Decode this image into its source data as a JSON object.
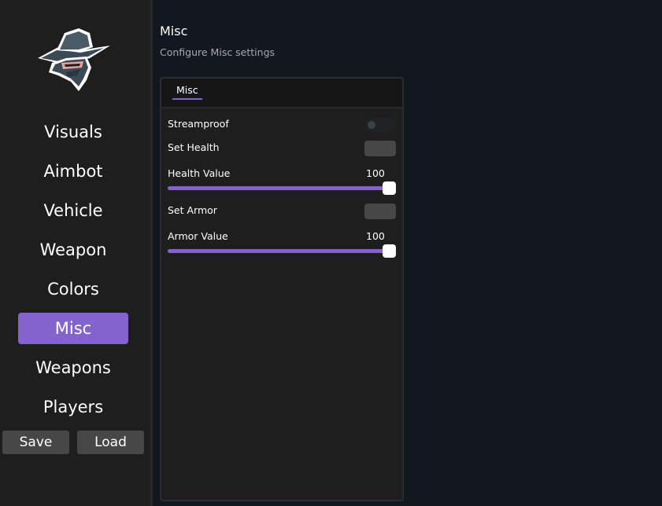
{
  "sidebar": {
    "logo": "hooded-ninja-logo",
    "items": [
      {
        "label": "Visuals",
        "active": false
      },
      {
        "label": "Aimbot",
        "active": false
      },
      {
        "label": "Vehicle",
        "active": false
      },
      {
        "label": "Weapon",
        "active": false
      },
      {
        "label": "Colors",
        "active": false
      },
      {
        "label": "Misc",
        "active": true
      },
      {
        "label": "Weapons",
        "active": false
      },
      {
        "label": "Players",
        "active": false
      }
    ],
    "save_label": "Save",
    "load_label": "Load"
  },
  "header": {
    "title": "Misc",
    "subtitle": "Configure Misc settings"
  },
  "panel": {
    "tab_label": "Misc",
    "streamproof": {
      "label": "Streamproof",
      "enabled": false
    },
    "set_health": {
      "label": "Set Health",
      "checked": false
    },
    "health_value": {
      "label": "Health Value",
      "value": "100",
      "fraction": 1.0
    },
    "set_armor": {
      "label": "Set Armor",
      "checked": false
    },
    "armor_value": {
      "label": "Armor Value",
      "value": "100",
      "fraction": 1.0
    }
  },
  "colors": {
    "accent": "#8563cf",
    "background": "#131720",
    "sidebar": "#1e1e1e",
    "button": "#474747"
  }
}
